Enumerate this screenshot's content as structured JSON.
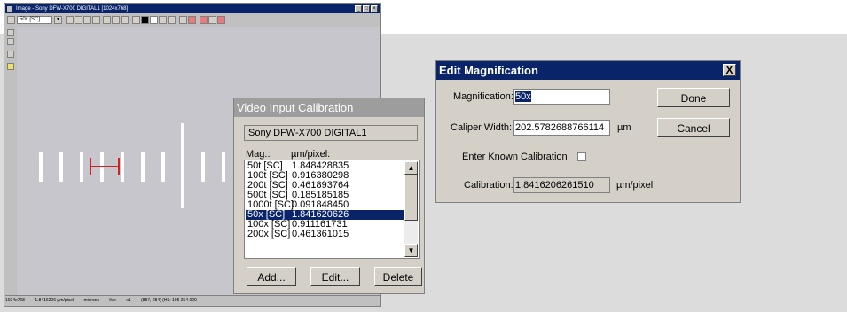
{
  "image_window": {
    "title": "Image - Sony DFW-X700 DIGITAL1 [1024x768]",
    "zoom_combo": "50x [SC]",
    "status_resolution": "1024x768",
    "status_calibration": "1.8416206 µm/pixel",
    "status_units": "microns",
    "status_mode": "live",
    "status_zoom": "x1",
    "status_coords": "(887, 284) (H3: 195 254 000"
  },
  "video_input_calibration": {
    "title": "Video Input Calibration",
    "camera": "Sony DFW-X700 DIGITAL1",
    "col_mag": "Mag.:",
    "col_pixel": "µm/pixel:",
    "rows": [
      {
        "mag": "50t [SC]",
        "value": "1.848428835",
        "selected": false
      },
      {
        "mag": "100t [SC]",
        "value": "0.916380298",
        "selected": false
      },
      {
        "mag": "200t [SC]",
        "value": "0.461893764",
        "selected": false
      },
      {
        "mag": "500t [SC]",
        "value": "0.185185185",
        "selected": false
      },
      {
        "mag": "1000t [SC]",
        "value": "0.091848450",
        "selected": false
      },
      {
        "mag": "50x [SC]",
        "value": "1.841620626",
        "selected": true
      },
      {
        "mag": "100x [SC]",
        "value": "0.911161731",
        "selected": false
      },
      {
        "mag": "200x [SC]",
        "value": "0.461361015",
        "selected": false
      }
    ],
    "add_label": "Add...",
    "edit_label": "Edit...",
    "delete_label": "Delete"
  },
  "edit_magnification": {
    "title": "Edit Magnification",
    "close_label": "X",
    "magnification_label": "Magnification:",
    "magnification_value": "50x",
    "caliper_label": "Caliper Width:",
    "caliper_value": "202.5782688766114",
    "caliper_unit": "µm",
    "known_label": "Enter Known Calibration",
    "calibration_label": "Calibration:",
    "calibration_value": "1.8416206261510",
    "calibration_unit": "µm/pixel",
    "done_label": "Done",
    "cancel_label": "Cancel"
  }
}
